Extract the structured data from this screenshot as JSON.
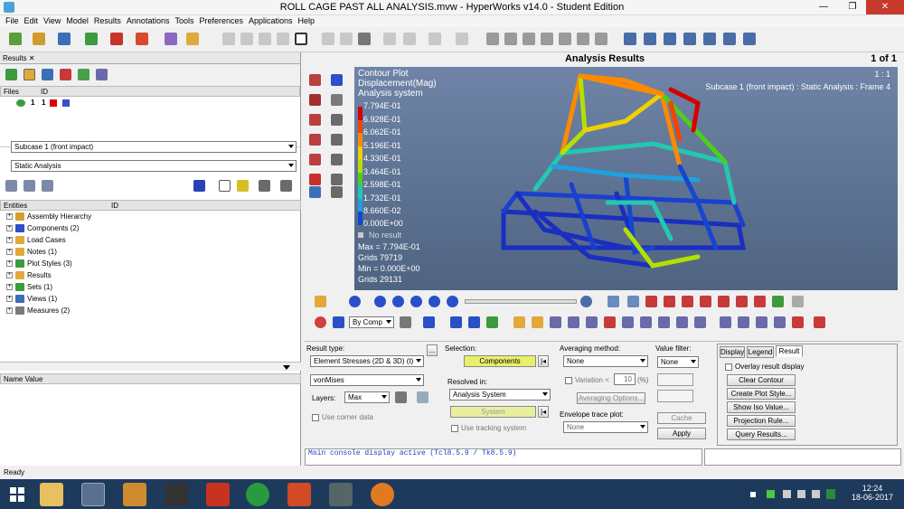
{
  "window": {
    "title": "ROLL CAGE PAST ALL ANALYSIS.mvw - HyperWorks v14.0 - Student Edition",
    "min": "—",
    "max": "❐",
    "close": "✕"
  },
  "menu": [
    "File",
    "Edit",
    "View",
    "Model",
    "Results",
    "Annotations",
    "Tools",
    "Preferences",
    "Applications",
    "Help"
  ],
  "left": {
    "tab": "Results",
    "tab_close": "✕",
    "files_header": "Files",
    "id_header": "ID",
    "file_row": {
      "num1": "1",
      "num2": "1"
    },
    "subcase": "Subcase 1 (front impact)",
    "analysis": "Static Analysis",
    "entities_header": "Entities",
    "id2": "ID",
    "tree": [
      "Assembly Hierarchy",
      "Components (2)",
      "Load Cases",
      "Notes (1)",
      "Plot Styles (3)",
      "Results",
      "Sets  (1)",
      "Views (1)",
      "Measures (2)"
    ],
    "name_header": "Name Value"
  },
  "analysis_header": "Analysis Results",
  "page_indicator": "1 of 1",
  "viewport": {
    "lines": [
      "Contour Plot",
      "Displacement(Mag)",
      "Analysis system"
    ],
    "ratio": "1 : 1",
    "subcase": "Subcase 1 (front impact) : Static Analysis : Frame 4",
    "legend_values": [
      "7.794E-01",
      "6.928E-01",
      "6.062E-01",
      "5.196E-01",
      "4.330E-01",
      "3.464E-01",
      "2.598E-01",
      "1.732E-01",
      "8.660E-02",
      "0.000E+00"
    ],
    "legend_colors": [
      "#d40000",
      "#f24400",
      "#ff8a00",
      "#f0d000",
      "#b4e000",
      "#4ccf1a",
      "#22c8b0",
      "#1fa0e0",
      "#1446d0",
      "#0a0aa0"
    ],
    "no_result": "No result",
    "max": "Max = 7.794E-01",
    "max_grids": "Grids 79719",
    "min": "Min = 0.000E+00",
    "min_grids": "Grids 29131"
  },
  "anim": {
    "bycomp": "By Comp"
  },
  "controls": {
    "result_type_label": "Result type:",
    "result_type": "Element Stresses (2D & 3D) (t)",
    "more": "...",
    "vonmises": "vonMises",
    "layers_label": "Layers:",
    "layers": "Max",
    "use_corner": "Use corner data",
    "selection_label": "Selection:",
    "components": "Components",
    "resolved_label": "Resolved in:",
    "resolved": "Analysis System",
    "system": "System",
    "use_tracking": "Use tracking system",
    "averaging_label": "Averaging method:",
    "averaging": "None",
    "variation": "Variation <",
    "variation_val": "10",
    "pct": "(%)",
    "avg_options": "Averaging Options...",
    "envelope_label": "Envelope trace plot:",
    "envelope": "None",
    "value_filter_label": "Value filter:",
    "value_filter": "None",
    "cache": "Cache",
    "apply": "Apply",
    "tabs": [
      "Display",
      "Legend",
      "Result"
    ],
    "overlay": "Overlay result display",
    "clear_contour": "Clear Contour",
    "create_plot_style": "Create Plot Style...",
    "show_iso": "Show Iso Value...",
    "projection": "Projection Rule...",
    "query": "Query Results..."
  },
  "console": {
    "line1": "Main console display active (Tcl8.5.9 / Tk8.5.9)"
  },
  "status": "Ready",
  "clock": {
    "time": "12:24",
    "date": "18-06-2017"
  }
}
